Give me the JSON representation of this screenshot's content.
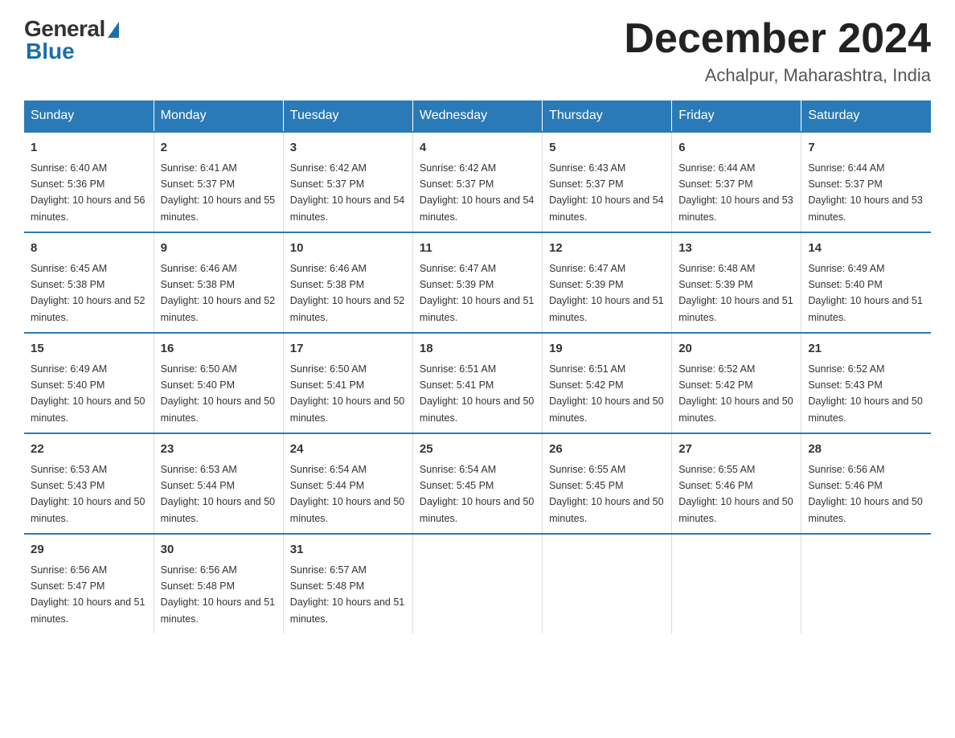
{
  "logo": {
    "general": "General",
    "blue": "Blue"
  },
  "title": "December 2024",
  "subtitle": "Achalpur, Maharashtra, India",
  "days_header": [
    "Sunday",
    "Monday",
    "Tuesday",
    "Wednesday",
    "Thursday",
    "Friday",
    "Saturday"
  ],
  "weeks": [
    [
      {
        "num": "1",
        "sunrise": "6:40 AM",
        "sunset": "5:36 PM",
        "daylight": "10 hours and 56 minutes."
      },
      {
        "num": "2",
        "sunrise": "6:41 AM",
        "sunset": "5:37 PM",
        "daylight": "10 hours and 55 minutes."
      },
      {
        "num": "3",
        "sunrise": "6:42 AM",
        "sunset": "5:37 PM",
        "daylight": "10 hours and 54 minutes."
      },
      {
        "num": "4",
        "sunrise": "6:42 AM",
        "sunset": "5:37 PM",
        "daylight": "10 hours and 54 minutes."
      },
      {
        "num": "5",
        "sunrise": "6:43 AM",
        "sunset": "5:37 PM",
        "daylight": "10 hours and 54 minutes."
      },
      {
        "num": "6",
        "sunrise": "6:44 AM",
        "sunset": "5:37 PM",
        "daylight": "10 hours and 53 minutes."
      },
      {
        "num": "7",
        "sunrise": "6:44 AM",
        "sunset": "5:37 PM",
        "daylight": "10 hours and 53 minutes."
      }
    ],
    [
      {
        "num": "8",
        "sunrise": "6:45 AM",
        "sunset": "5:38 PM",
        "daylight": "10 hours and 52 minutes."
      },
      {
        "num": "9",
        "sunrise": "6:46 AM",
        "sunset": "5:38 PM",
        "daylight": "10 hours and 52 minutes."
      },
      {
        "num": "10",
        "sunrise": "6:46 AM",
        "sunset": "5:38 PM",
        "daylight": "10 hours and 52 minutes."
      },
      {
        "num": "11",
        "sunrise": "6:47 AM",
        "sunset": "5:39 PM",
        "daylight": "10 hours and 51 minutes."
      },
      {
        "num": "12",
        "sunrise": "6:47 AM",
        "sunset": "5:39 PM",
        "daylight": "10 hours and 51 minutes."
      },
      {
        "num": "13",
        "sunrise": "6:48 AM",
        "sunset": "5:39 PM",
        "daylight": "10 hours and 51 minutes."
      },
      {
        "num": "14",
        "sunrise": "6:49 AM",
        "sunset": "5:40 PM",
        "daylight": "10 hours and 51 minutes."
      }
    ],
    [
      {
        "num": "15",
        "sunrise": "6:49 AM",
        "sunset": "5:40 PM",
        "daylight": "10 hours and 50 minutes."
      },
      {
        "num": "16",
        "sunrise": "6:50 AM",
        "sunset": "5:40 PM",
        "daylight": "10 hours and 50 minutes."
      },
      {
        "num": "17",
        "sunrise": "6:50 AM",
        "sunset": "5:41 PM",
        "daylight": "10 hours and 50 minutes."
      },
      {
        "num": "18",
        "sunrise": "6:51 AM",
        "sunset": "5:41 PM",
        "daylight": "10 hours and 50 minutes."
      },
      {
        "num": "19",
        "sunrise": "6:51 AM",
        "sunset": "5:42 PM",
        "daylight": "10 hours and 50 minutes."
      },
      {
        "num": "20",
        "sunrise": "6:52 AM",
        "sunset": "5:42 PM",
        "daylight": "10 hours and 50 minutes."
      },
      {
        "num": "21",
        "sunrise": "6:52 AM",
        "sunset": "5:43 PM",
        "daylight": "10 hours and 50 minutes."
      }
    ],
    [
      {
        "num": "22",
        "sunrise": "6:53 AM",
        "sunset": "5:43 PM",
        "daylight": "10 hours and 50 minutes."
      },
      {
        "num": "23",
        "sunrise": "6:53 AM",
        "sunset": "5:44 PM",
        "daylight": "10 hours and 50 minutes."
      },
      {
        "num": "24",
        "sunrise": "6:54 AM",
        "sunset": "5:44 PM",
        "daylight": "10 hours and 50 minutes."
      },
      {
        "num": "25",
        "sunrise": "6:54 AM",
        "sunset": "5:45 PM",
        "daylight": "10 hours and 50 minutes."
      },
      {
        "num": "26",
        "sunrise": "6:55 AM",
        "sunset": "5:45 PM",
        "daylight": "10 hours and 50 minutes."
      },
      {
        "num": "27",
        "sunrise": "6:55 AM",
        "sunset": "5:46 PM",
        "daylight": "10 hours and 50 minutes."
      },
      {
        "num": "28",
        "sunrise": "6:56 AM",
        "sunset": "5:46 PM",
        "daylight": "10 hours and 50 minutes."
      }
    ],
    [
      {
        "num": "29",
        "sunrise": "6:56 AM",
        "sunset": "5:47 PM",
        "daylight": "10 hours and 51 minutes."
      },
      {
        "num": "30",
        "sunrise": "6:56 AM",
        "sunset": "5:48 PM",
        "daylight": "10 hours and 51 minutes."
      },
      {
        "num": "31",
        "sunrise": "6:57 AM",
        "sunset": "5:48 PM",
        "daylight": "10 hours and 51 minutes."
      },
      null,
      null,
      null,
      null
    ]
  ]
}
